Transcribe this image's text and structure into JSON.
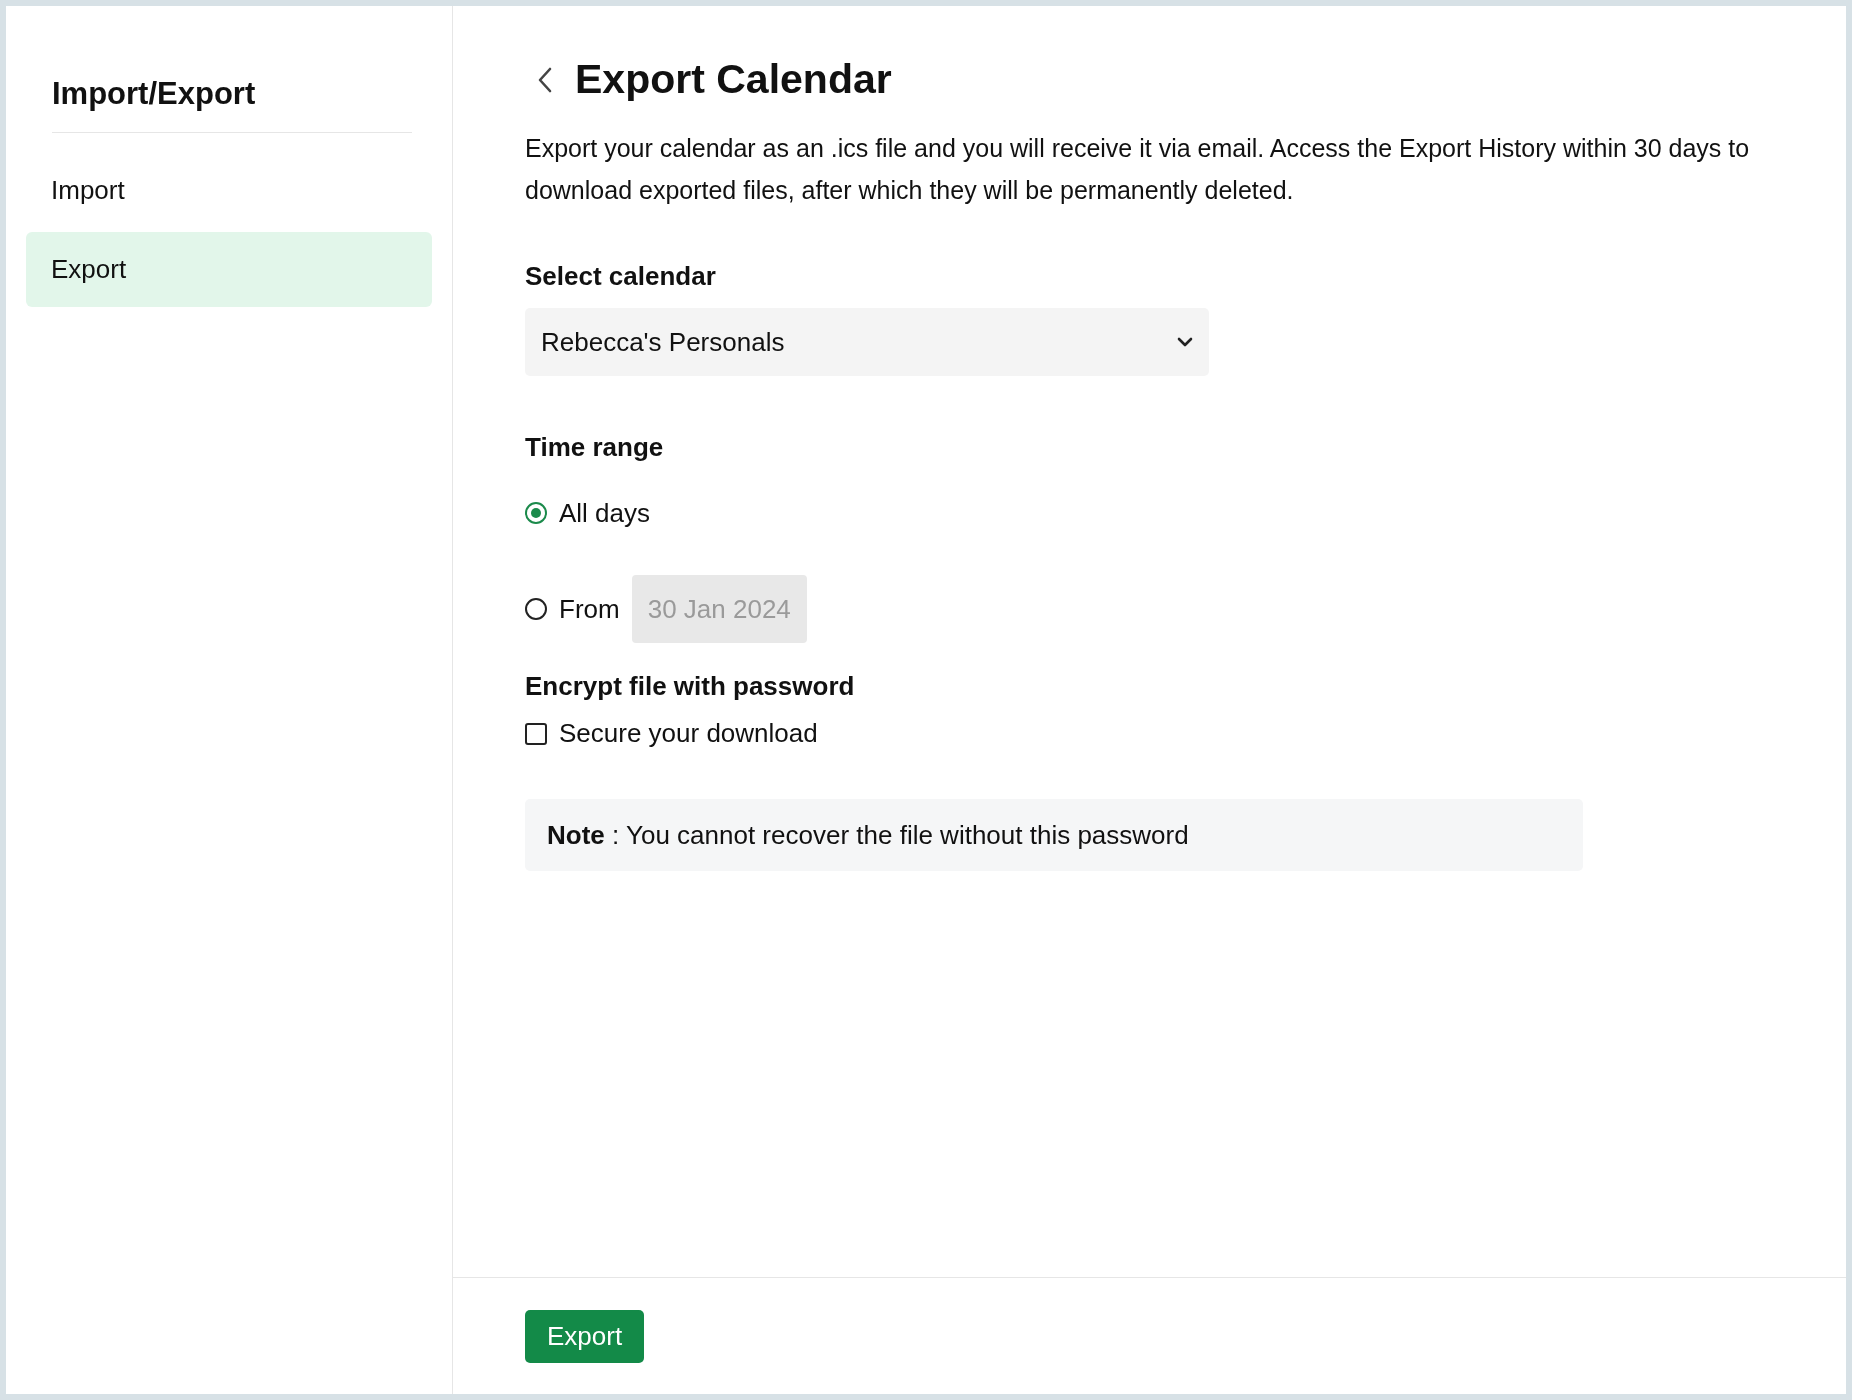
{
  "sidebar": {
    "title": "Import/Export",
    "items": [
      {
        "label": "Import",
        "selected": false
      },
      {
        "label": "Export",
        "selected": true
      }
    ]
  },
  "title": "Export Calendar",
  "description": "Export your calendar as an .ics file and you will receive it via email. Access the Export History within 30 days to download exported files, after which they will be permanently deleted.",
  "calendar": {
    "label": "Select calendar",
    "value": "Rebecca's Personals"
  },
  "time_range": {
    "label": "Time range",
    "options": [
      {
        "label": "All days",
        "selected": true
      },
      {
        "label": "From",
        "selected": false,
        "date": "30 Jan 2024",
        "disabled": true
      }
    ]
  },
  "encrypt": {
    "label": "Encrypt file with password",
    "checkbox": {
      "label": "Secure your download",
      "checked": false
    }
  },
  "note": "**Note** : You cannot recover the file without this password",
  "footer": {
    "button": "Export"
  }
}
